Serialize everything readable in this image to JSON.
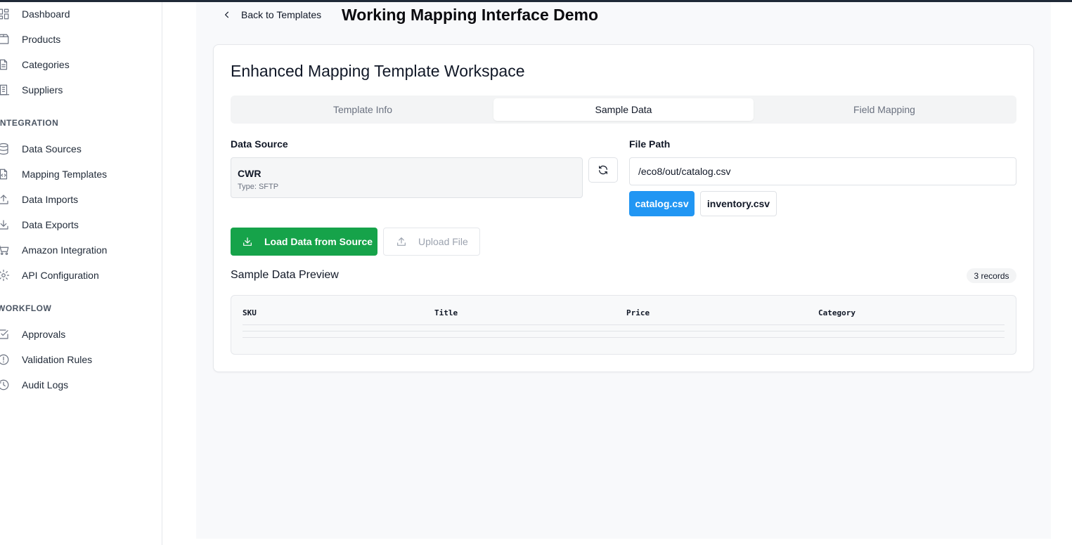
{
  "sidebar": {
    "items": [
      {
        "label": "Dashboard",
        "icon": "dashboard-icon"
      },
      {
        "label": "Products",
        "icon": "package-icon"
      },
      {
        "label": "Categories",
        "icon": "document-list-icon"
      },
      {
        "label": "Suppliers",
        "icon": "building-icon"
      }
    ],
    "integration_label": "INTEGRATION",
    "integration_items": [
      {
        "label": "Data Sources",
        "icon": "database-icon"
      },
      {
        "label": "Mapping Templates",
        "icon": "code-file-icon"
      },
      {
        "label": "Data Imports",
        "icon": "upload-icon"
      },
      {
        "label": "Data Exports",
        "icon": "download-icon"
      },
      {
        "label": "Amazon Integration",
        "icon": "cart-icon"
      },
      {
        "label": "API Configuration",
        "icon": "gear-icon"
      }
    ],
    "workflow_label": "WORKFLOW",
    "workflow_items": [
      {
        "label": "Approvals",
        "icon": "check-square-icon"
      },
      {
        "label": "Validation Rules",
        "icon": "alert-circle-icon"
      },
      {
        "label": "Audit Logs",
        "icon": "history-icon"
      }
    ]
  },
  "header": {
    "back_label": "Back to Templates",
    "title": "Working Mapping Interface Demo"
  },
  "workspace": {
    "title": "Enhanced Mapping Template Workspace",
    "tabs": [
      "Template Info",
      "Sample Data",
      "Field Mapping"
    ],
    "active_tab": "Sample Data"
  },
  "data_source": {
    "label": "Data Source",
    "name": "CWR",
    "type": "Type: SFTP"
  },
  "file_path": {
    "label": "File Path",
    "value": "/eco8/out/catalog.csv",
    "files": [
      "catalog.csv",
      "inventory.csv"
    ],
    "selected": "catalog.csv"
  },
  "actions": {
    "load_label": "Load Data from Source",
    "upload_label": "Upload File"
  },
  "preview": {
    "title": "Sample Data Preview",
    "records": "3 records",
    "columns": [
      "SKU",
      "Title",
      "Price",
      "Category"
    ]
  },
  "colors": {
    "primary_green": "#16a34a",
    "selected_blue": "#2196f3"
  }
}
